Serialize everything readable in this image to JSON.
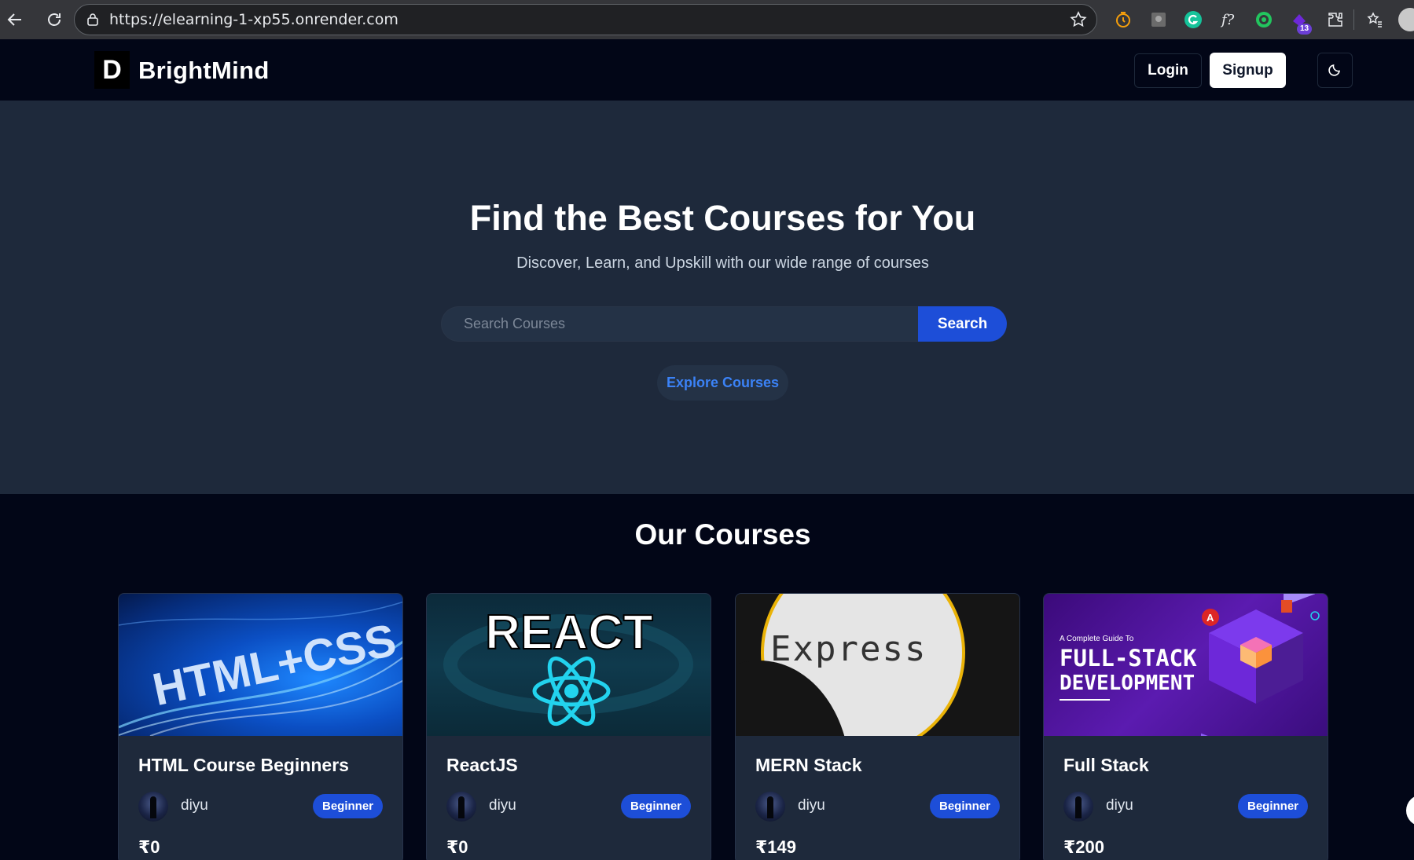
{
  "browser": {
    "url": "https://elearning-1-xp55.onrender.com",
    "extension_badge": "13"
  },
  "navbar": {
    "logo_letter": "D",
    "brand": "BrightMind",
    "login_label": "Login",
    "signup_label": "Signup"
  },
  "hero": {
    "title": "Find the Best Courses for You",
    "subtitle": "Discover, Learn, and Upskill with our wide range of courses",
    "search_placeholder": "Search Courses",
    "search_label": "Search",
    "explore_label": "Explore Courses"
  },
  "courses": {
    "heading": "Our Courses",
    "items": [
      {
        "title": "HTML Course Beginners",
        "author": "diyu",
        "level": "Beginner",
        "price": "₹0",
        "thumb_text": "HTML+CSS"
      },
      {
        "title": "ReactJS",
        "author": "diyu",
        "level": "Beginner",
        "price": "₹0",
        "thumb_text": "REACT"
      },
      {
        "title": "MERN Stack",
        "author": "diyu",
        "level": "Beginner",
        "price": "₹149",
        "thumb_text": "Express"
      },
      {
        "title": "Full Stack",
        "author": "diyu",
        "level": "Beginner",
        "price": "₹200",
        "thumb_small": "A Complete Guide To",
        "thumb_line1": "FULL-STACK",
        "thumb_line2": "DEVELOPMENT"
      }
    ]
  },
  "colors": {
    "page_bg": "#020617",
    "hero_bg": "#1e293b",
    "accent": "#1d4ed8"
  }
}
